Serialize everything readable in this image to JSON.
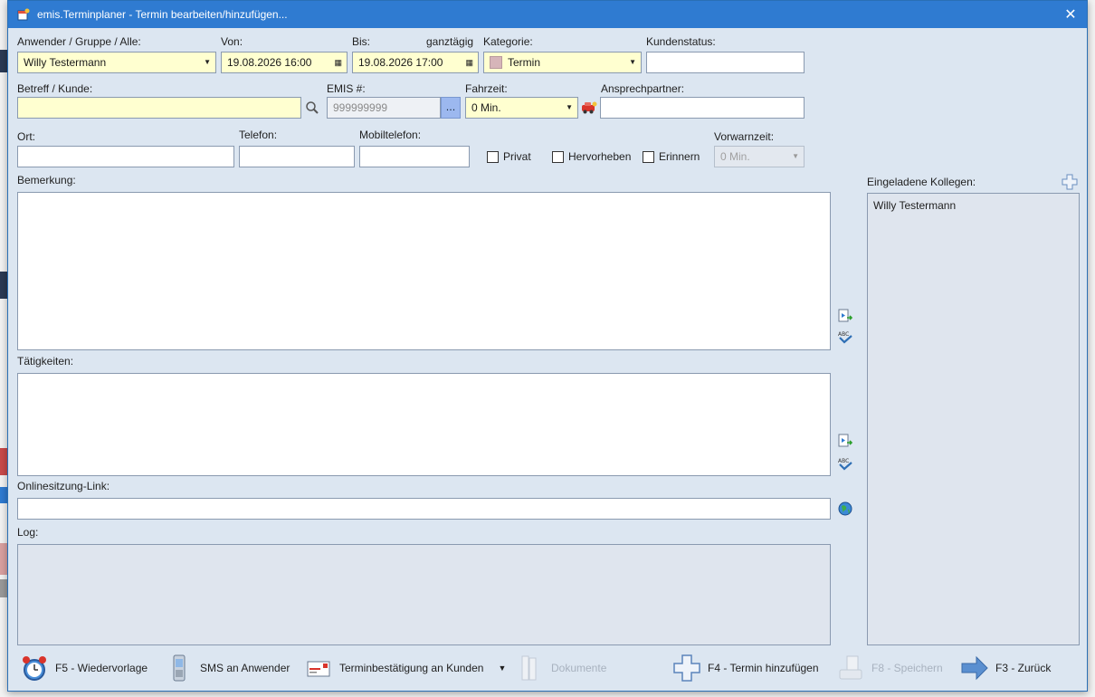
{
  "window": {
    "title": "emis.Terminplaner - Termin bearbeiten/hinzufügen...",
    "close_icon": "close-icon"
  },
  "labels": {
    "anwender": "Anwender / Gruppe / Alle:",
    "von": "Von:",
    "bis": "Bis:",
    "ganztaegig": "ganztägig",
    "kategorie": "Kategorie:",
    "kundenstatus": "Kundenstatus:",
    "betreff": "Betreff / Kunde:",
    "emis": "EMIS #:",
    "fahrzeit": "Fahrzeit:",
    "ansprechpartner": "Ansprechpartner:",
    "ort": "Ort:",
    "telefon": "Telefon:",
    "mobiltelefon": "Mobiltelefon:",
    "vorwarnzeit": "Vorwarnzeit:",
    "bemerkung": "Bemerkung:",
    "taetigkeiten": "Tätigkeiten:",
    "onlinesitzung": "Onlinesitzung-Link:",
    "log": "Log:",
    "eingeladene": "Eingeladene Kollegen:"
  },
  "fields": {
    "anwender": "Willy Testermann",
    "von": "19.08.2026 16:00",
    "bis": "19.08.2026 17:00",
    "kategorie": "Termin",
    "kategorie_color": "#d6b5b9",
    "kundenstatus": "",
    "betreff": "",
    "emis_placeholder": "999999999",
    "fahrzeit": "0 Min.",
    "ansprechpartner": "",
    "ort": "",
    "telefon": "",
    "mobiltelefon": "",
    "vorwarnzeit": "0 Min.",
    "onlinesitzung": "",
    "dots": "..."
  },
  "checkboxes": {
    "privat": {
      "label": "Privat",
      "checked": false
    },
    "hervorheben": {
      "label": "Hervorheben",
      "checked": false
    },
    "erinnern": {
      "label": "Erinnern",
      "checked": false
    }
  },
  "kollegen": [
    "Willy Testermann"
  ],
  "toolbar": {
    "wiedervorlage": "F5 - Wiedervorlage",
    "sms": "SMS an Anwender",
    "terminbestaetigung": "Terminbestätigung an Kunden",
    "dokumente": "Dokumente",
    "termin_hinzufuegen": "F4 - Termin hinzufügen",
    "speichern": "F8 - Speichern",
    "zurueck": "F3 - Zurück"
  }
}
